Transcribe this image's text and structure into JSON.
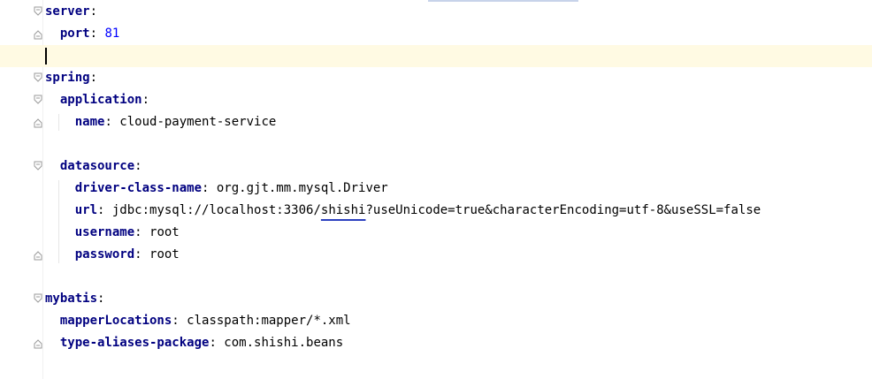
{
  "editor": {
    "lines": [
      {
        "indent": 0,
        "key": "server",
        "sep": ":",
        "value": "",
        "value_type": "none",
        "fold": "open"
      },
      {
        "indent": 1,
        "key": "port",
        "sep": ": ",
        "value": "81",
        "value_type": "number",
        "fold": "close"
      },
      {
        "indent": 0,
        "key": "",
        "sep": "",
        "value": "",
        "value_type": "none",
        "fold": "none",
        "current": true
      },
      {
        "indent": 0,
        "key": "spring",
        "sep": ":",
        "value": "",
        "value_type": "none",
        "fold": "open"
      },
      {
        "indent": 1,
        "key": "application",
        "sep": ":",
        "value": "",
        "value_type": "none",
        "fold": "open"
      },
      {
        "indent": 2,
        "key": "name",
        "sep": ": ",
        "value": "cloud-payment-service",
        "value_type": "string",
        "fold": "close"
      },
      {
        "indent": 0,
        "key": "",
        "sep": "",
        "value": "",
        "value_type": "none",
        "fold": "none"
      },
      {
        "indent": 1,
        "key": "datasource",
        "sep": ":",
        "value": "",
        "value_type": "none",
        "fold": "open"
      },
      {
        "indent": 2,
        "key": "driver-class-name",
        "sep": ": ",
        "value": "org.gjt.mm.mysql.Driver",
        "value_type": "string",
        "fold": "none"
      },
      {
        "indent": 2,
        "key": "url",
        "sep": ": ",
        "value_pre": "jdbc:mysql://localhost:3306/",
        "value_flag": "shishi",
        "value_post": "?useUnicode=true&characterEncoding=utf-8&useSSL=false",
        "value_type": "url",
        "fold": "none"
      },
      {
        "indent": 2,
        "key": "username",
        "sep": ": ",
        "value": "root",
        "value_type": "string",
        "fold": "none"
      },
      {
        "indent": 2,
        "key": "password",
        "sep": ": ",
        "value": "root",
        "value_type": "string",
        "fold": "close"
      },
      {
        "indent": 0,
        "key": "",
        "sep": "",
        "value": "",
        "value_type": "none",
        "fold": "none"
      },
      {
        "indent": 0,
        "key": "mybatis",
        "sep": ":",
        "value": "",
        "value_type": "none",
        "fold": "open"
      },
      {
        "indent": 1,
        "key": "mapperLocations",
        "sep": ": ",
        "value": "classpath:mapper/*.xml",
        "value_type": "string",
        "fold": "none"
      },
      {
        "indent": 1,
        "key": "type-aliases-package",
        "sep": ": ",
        "value": "com.shishi.beans",
        "value_type": "string",
        "fold": "close"
      }
    ]
  },
  "colors": {
    "key": "#000080",
    "number": "#0000ff",
    "current_line": "#fffae3",
    "squiggle": "#2b3fbf",
    "fold_icon": "#9a9a9a"
  },
  "icons": {
    "fold_open": "fold-open-icon",
    "fold_close": "fold-close-icon"
  }
}
